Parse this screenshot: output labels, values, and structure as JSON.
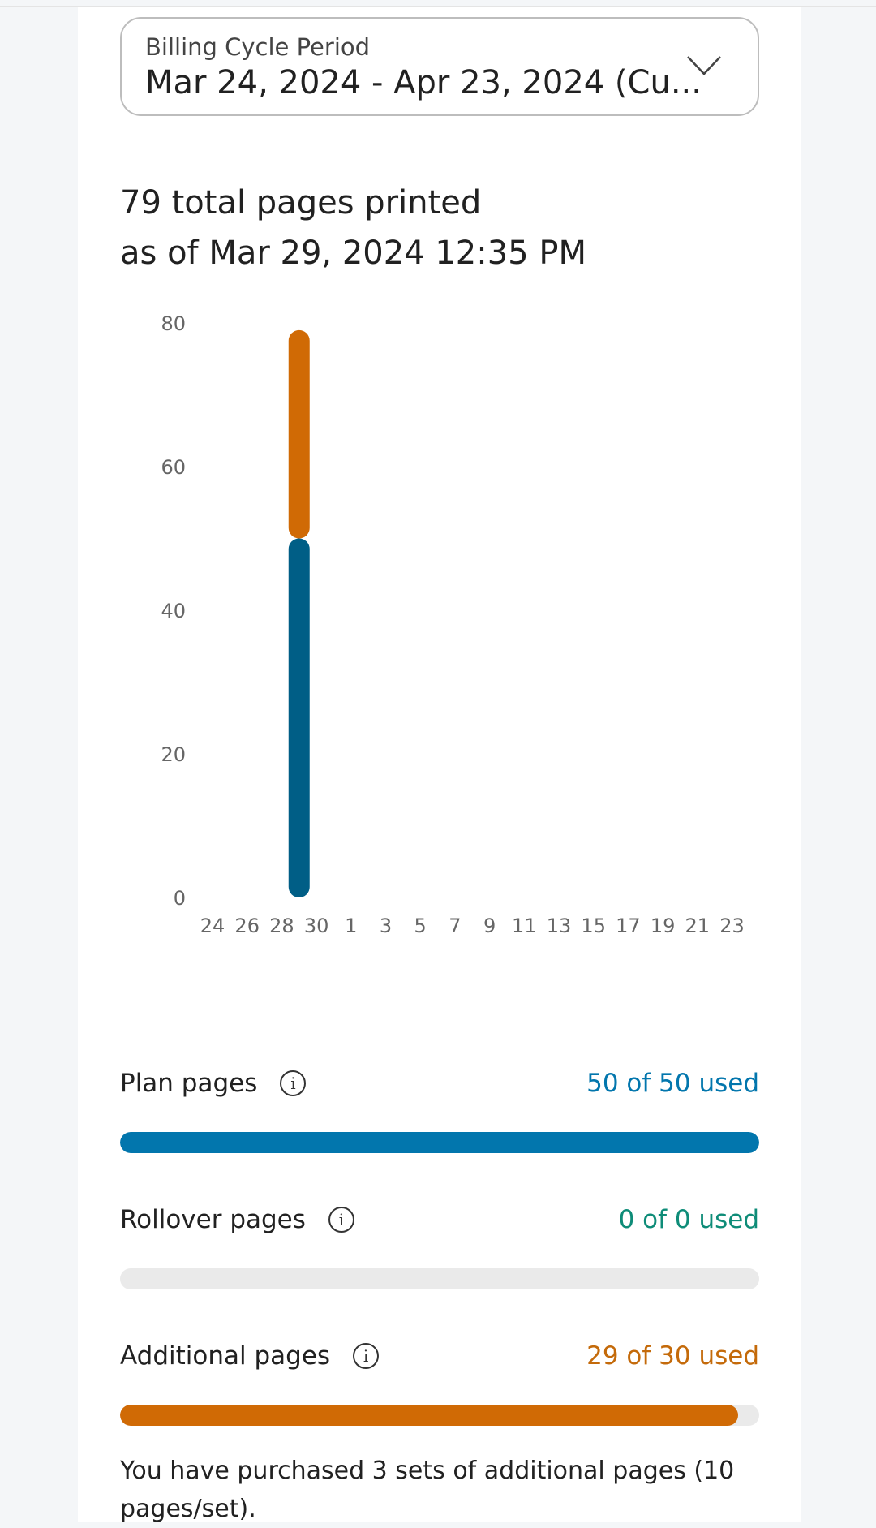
{
  "billing": {
    "label": "Billing Cycle Period",
    "value": "Mar 24, 2024 - Apr 23, 2024 (Cu..."
  },
  "summary": {
    "line1": "79 total pages printed",
    "line2": "as of Mar 29, 2024 12:35 PM"
  },
  "chart_data": {
    "type": "bar",
    "stacked": true,
    "ylim": [
      0,
      80
    ],
    "yticks": [
      0,
      20,
      40,
      60,
      80
    ],
    "x_tick_labels": [
      "24",
      "26",
      "28",
      "30",
      "1",
      "3",
      "5",
      "7",
      "9",
      "11",
      "13",
      "15",
      "17",
      "19",
      "21",
      "23"
    ],
    "bars": [
      {
        "x": "Mar 29",
        "segments": [
          {
            "value": 50,
            "color": "#005e86"
          },
          {
            "value": 29,
            "color": "#d06a05"
          }
        ]
      }
    ]
  },
  "meters": [
    {
      "name": "Plan pages",
      "count": "50 of 50 used",
      "used": 50,
      "total": 50,
      "color": "#0276ad",
      "count_color": "#0276ad",
      "info_icon": "info-icon"
    },
    {
      "name": "Rollover pages",
      "count": "0 of 0 used",
      "used": 0,
      "total": 0,
      "color": "#0e8c78",
      "count_color": "#0e8c78",
      "info_icon": "info-icon"
    },
    {
      "name": "Additional pages",
      "count": "29 of 30 used",
      "used": 29,
      "total": 30,
      "color": "#d06a05",
      "count_color": "#c46a0a",
      "info_icon": "info-icon"
    }
  ],
  "note": "You have purchased 3 sets of additional pages (10 pages/set).",
  "info_glyph": "i"
}
